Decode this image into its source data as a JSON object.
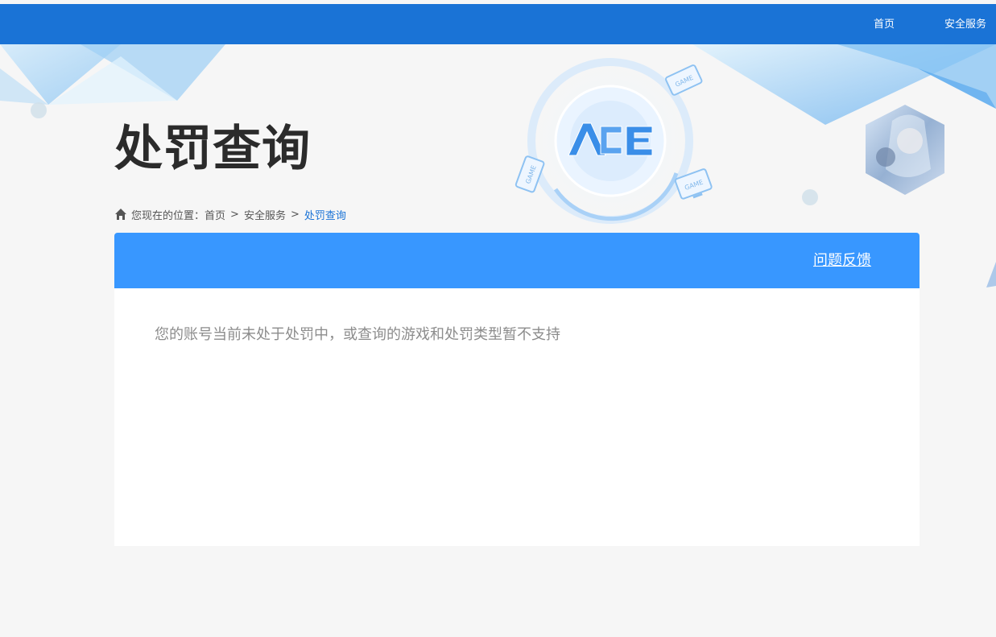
{
  "nav": {
    "home": "首页",
    "security": "安全服务"
  },
  "page_title": "处罚查询",
  "breadcrumb": {
    "prefix": "您现在的位置：",
    "items": [
      "首页",
      "安全服务",
      "处罚查询"
    ],
    "separator": ">"
  },
  "card": {
    "feedback_label": "问题反馈",
    "message": "您的账号当前未处于处罚中，或查询的游戏和处罚类型暂不支持"
  },
  "banner": {
    "logo_text": "ACE",
    "device_label": "GAME"
  },
  "colors": {
    "nav_bg": "#1a73d6",
    "card_header_bg": "#3897ff",
    "accent": "#1a73d6"
  }
}
